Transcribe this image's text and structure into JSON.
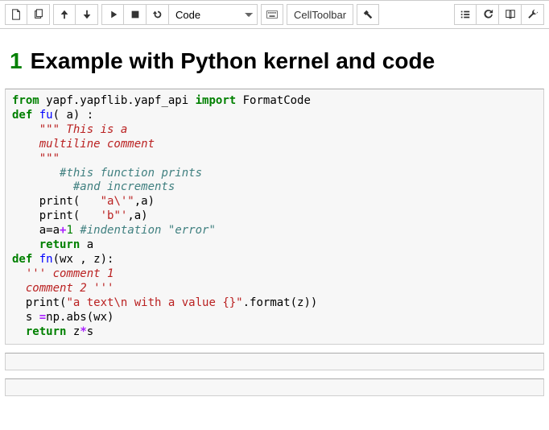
{
  "toolbar": {
    "celltype": "Code",
    "celltoolbar": "CellToolbar"
  },
  "heading": {
    "num": "1",
    "title": "Example with Python kernel and code"
  },
  "code": {
    "l1_from": "from",
    "l1_mod": "yapf.yapflib.yapf_api",
    "l1_import": "import",
    "l1_name": "FormatCode",
    "l2_def": "def",
    "l2_fn": "fu",
    "l2_rest": "( a) :",
    "l3": "\"\"\" This is a",
    "l4": "multiline comment",
    "l5": "\"\"\"",
    "l6": "#this function prints",
    "l7": "#and increments",
    "l8_p": "print",
    "l8_s": "\"a\\'\"",
    "l8_r": ",a)",
    "l9_p": "print",
    "l9_s": "'b\"'",
    "l9_r": ",a)",
    "l10_pre": "a=a",
    "l10_op": "+",
    "l10_num": "1",
    "l10_com": "#indentation \"error\"",
    "l11_ret": "return",
    "l11_rest": "a",
    "l12_def": "def",
    "l12_fn": "fn",
    "l12_rest": "(wx , z):",
    "l13": "''' comment 1",
    "l14": "comment 2 '''",
    "l15_p": "print",
    "l15_s": "\"a text\\n with a value {}\"",
    "l15_fmt": ".format(z))",
    "l16_pre": "s ",
    "l16_op": "=",
    "l16_rest": "np.abs(wx)",
    "l17_ret": "return",
    "l17_a": "z",
    "l17_op": "*",
    "l17_b": "s"
  },
  "chart_data": null
}
